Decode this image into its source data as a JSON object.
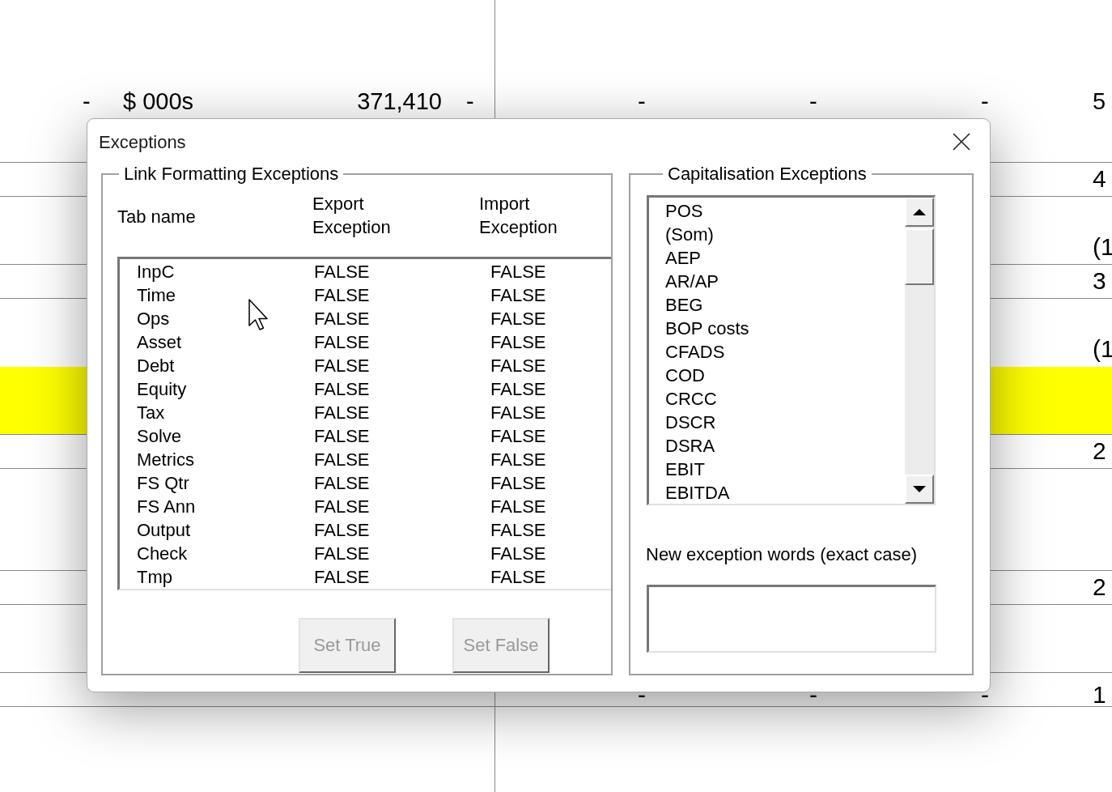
{
  "sheet": {
    "rows": [
      {
        "ruled": false,
        "highlighted": false,
        "cells": [
          "-",
          "$ 000s",
          "371,410",
          "-",
          "-",
          "-",
          "-",
          "5"
        ]
      },
      {
        "ruled": true,
        "highlighted": false,
        "cells": []
      },
      {
        "ruled": true,
        "highlighted": false,
        "cells": [
          "",
          "",
          "",
          "",
          "",
          "",
          "",
          "4"
        ]
      },
      {
        "ruled": false,
        "highlighted": false,
        "cells": []
      },
      {
        "ruled": true,
        "highlighted": false,
        "cells": [
          "",
          "",
          "",
          "",
          "",
          "",
          "",
          "(1"
        ]
      },
      {
        "ruled": true,
        "highlighted": false,
        "cells": [
          "",
          "",
          "",
          "",
          "",
          "",
          "",
          "3"
        ]
      },
      {
        "ruled": false,
        "highlighted": false,
        "cells": []
      },
      {
        "ruled": false,
        "highlighted": false,
        "cells": [
          "",
          "",
          "",
          "",
          "",
          "",
          "",
          "(1"
        ]
      },
      {
        "ruled": false,
        "highlighted": true,
        "cells": []
      },
      {
        "ruled": true,
        "highlighted": true,
        "cells": []
      },
      {
        "ruled": true,
        "highlighted": false,
        "cells": [
          "",
          "",
          "",
          "",
          "",
          "",
          "",
          "2"
        ]
      },
      {
        "ruled": false,
        "highlighted": false,
        "cells": []
      },
      {
        "ruled": false,
        "highlighted": false,
        "cells": []
      },
      {
        "ruled": true,
        "highlighted": false,
        "cells": []
      },
      {
        "ruled": true,
        "highlighted": false,
        "cells": [
          "",
          "",
          "",
          "",
          "",
          "",
          "",
          "2"
        ]
      },
      {
        "ruled": false,
        "highlighted": false,
        "cells": []
      },
      {
        "ruled": true,
        "highlighted": false,
        "cells": []
      },
      {
        "ruled": true,
        "highlighted": false,
        "cells": [
          "",
          "",
          "",
          "",
          "-",
          "-",
          "-",
          "1"
        ]
      }
    ]
  },
  "dialog": {
    "title": "Exceptions",
    "link_group": {
      "legend": "Link Formatting Exceptions",
      "columns": [
        "Tab name",
        "Export\nException",
        "Import\nException"
      ],
      "rows": [
        [
          "InpC",
          "FALSE",
          "FALSE"
        ],
        [
          "Time",
          "FALSE",
          "FALSE"
        ],
        [
          "Ops",
          "FALSE",
          "FALSE"
        ],
        [
          "Asset",
          "FALSE",
          "FALSE"
        ],
        [
          "Debt",
          "FALSE",
          "FALSE"
        ],
        [
          "Equity",
          "FALSE",
          "FALSE"
        ],
        [
          "Tax",
          "FALSE",
          "FALSE"
        ],
        [
          "Solve",
          "FALSE",
          "FALSE"
        ],
        [
          "Metrics",
          "FALSE",
          "FALSE"
        ],
        [
          "FS Qtr",
          "FALSE",
          "FALSE"
        ],
        [
          "FS Ann",
          "FALSE",
          "FALSE"
        ],
        [
          "Output",
          "FALSE",
          "FALSE"
        ],
        [
          "Check",
          "FALSE",
          "FALSE"
        ],
        [
          "Tmp",
          "FALSE",
          "FALSE"
        ]
      ],
      "buttons": [
        {
          "label": "Set True",
          "disabled": true
        },
        {
          "label": "Set False",
          "disabled": true
        }
      ]
    },
    "cap_group": {
      "legend": "Capitalisation Exceptions",
      "words": [
        "POS",
        "(Som)",
        "AEP",
        "AR/AP",
        "BEG",
        "BOP costs",
        "CFADS",
        "COD",
        "CRCC",
        "DSCR",
        "DSRA",
        "EBIT",
        "EBITDA"
      ],
      "field_label": "New exception words (exact case)"
    }
  }
}
